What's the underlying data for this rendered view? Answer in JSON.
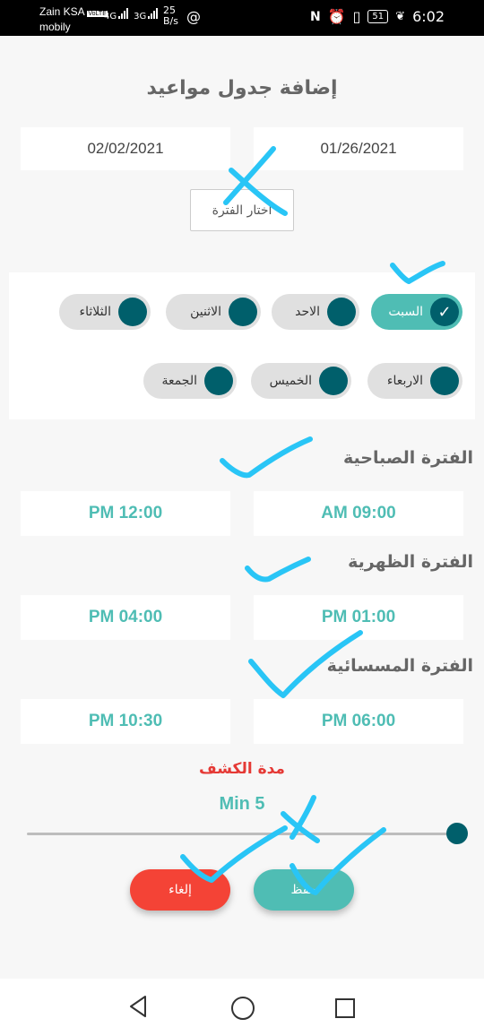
{
  "status_bar": {
    "carrier_primary": "Zain KSA",
    "carrier_badge": "VoLTE",
    "carrier_secondary": "mobily",
    "signal_1": "4G",
    "signal_2": "3G",
    "net_speed_value": "25",
    "net_speed_unit": "B/s",
    "battery": "51",
    "time": "6:02"
  },
  "page": {
    "title": "إضافة جدول مواعيد"
  },
  "dates": {
    "start": "01/26/2021",
    "end": "02/02/2021",
    "choose_label": "اختار الفترة"
  },
  "days": [
    {
      "label": "السبت",
      "active": true
    },
    {
      "label": "الاحد",
      "active": false
    },
    {
      "label": "الاثنين",
      "active": false
    },
    {
      "label": "الثلاثاء",
      "active": false
    },
    {
      "label": "الاربعاء",
      "active": false
    },
    {
      "label": "الخميس",
      "active": false
    },
    {
      "label": "الجمعة",
      "active": false
    }
  ],
  "periods": {
    "morning": {
      "title": "الفترة الصباحية",
      "from": "AM 09:00",
      "to": "PM 12:00"
    },
    "noon": {
      "title": "الفترة الظهرية",
      "from": "PM 01:00",
      "to": "PM 04:00"
    },
    "evening": {
      "title": "الفترة المسسائية",
      "from": "PM 06:00",
      "to": "PM 10:30"
    }
  },
  "duration": {
    "title": "مدة الكشف",
    "value": "Min 5",
    "level": 1.0
  },
  "actions": {
    "save_label": "حفظ",
    "cancel_label": "إلغاء"
  },
  "colors": {
    "accent": "#4fbdb4",
    "knob": "#005f6b",
    "danger": "#f44336",
    "annotation": "#29c5f6"
  }
}
